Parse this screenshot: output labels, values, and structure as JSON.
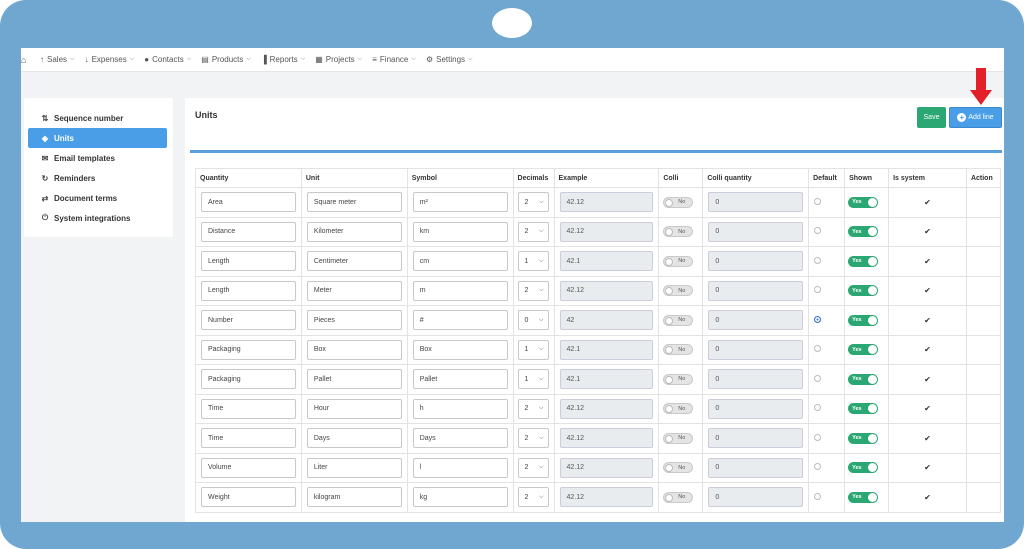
{
  "nav": {
    "items": [
      {
        "label": "Sales",
        "icon": "arrow-up-icon"
      },
      {
        "label": "Expenses",
        "icon": "arrow-down-icon"
      },
      {
        "label": "Contacts",
        "icon": "user-icon"
      },
      {
        "label": "Products",
        "icon": "cart-icon"
      },
      {
        "label": "Reports",
        "icon": "chart-icon"
      },
      {
        "label": "Projects",
        "icon": "calendar-icon"
      },
      {
        "label": "Finance",
        "icon": "money-icon"
      },
      {
        "label": "Settings",
        "icon": "gear-icon"
      }
    ]
  },
  "sidebar": {
    "items": [
      {
        "label": "Sequence number",
        "icon": "sort-icon",
        "active": false
      },
      {
        "label": "Units",
        "icon": "cube-icon",
        "active": true
      },
      {
        "label": "Email templates",
        "icon": "envelope-icon",
        "active": false
      },
      {
        "label": "Reminders",
        "icon": "refresh-icon",
        "active": false
      },
      {
        "label": "Document terms",
        "icon": "exchange-icon",
        "active": false
      },
      {
        "label": "System integrations",
        "icon": "plug-icon",
        "active": false
      }
    ]
  },
  "content": {
    "title": "Units",
    "save_label": "Save",
    "add_line_label": "Add line"
  },
  "table": {
    "headers": {
      "quantity": "Quantity",
      "unit": "Unit",
      "symbol": "Symbol",
      "decimals": "Decimals",
      "example": "Example",
      "colli": "Colli",
      "colli_quantity": "Colli quantity",
      "default": "Default",
      "shown": "Shown",
      "is_system": "Is system",
      "action": "Action"
    },
    "rows": [
      {
        "quantity": "Area",
        "unit": "Square meter",
        "symbol": "m²",
        "decimals": "2",
        "example": "42.12",
        "colli": "No",
        "colli_quantity": "0",
        "default": false,
        "shown": "Yes"
      },
      {
        "quantity": "Distance",
        "unit": "Kilometer",
        "symbol": "km",
        "decimals": "2",
        "example": "42.12",
        "colli": "No",
        "colli_quantity": "0",
        "default": false,
        "shown": "Yes"
      },
      {
        "quantity": "Length",
        "unit": "Centimeter",
        "symbol": "cm",
        "decimals": "1",
        "example": "42.1",
        "colli": "No",
        "colli_quantity": "0",
        "default": false,
        "shown": "Yes"
      },
      {
        "quantity": "Length",
        "unit": "Meter",
        "symbol": "m",
        "decimals": "2",
        "example": "42.12",
        "colli": "No",
        "colli_quantity": "0",
        "default": false,
        "shown": "Yes"
      },
      {
        "quantity": "Number",
        "unit": "Pieces",
        "symbol": "#",
        "decimals": "0",
        "example": "42",
        "colli": "No",
        "colli_quantity": "0",
        "default": true,
        "shown": "Yes"
      },
      {
        "quantity": "Packaging",
        "unit": "Box",
        "symbol": "Box",
        "decimals": "1",
        "example": "42.1",
        "colli": "No",
        "colli_quantity": "0",
        "default": false,
        "shown": "Yes"
      },
      {
        "quantity": "Packaging",
        "unit": "Pallet",
        "symbol": "Pallet",
        "decimals": "1",
        "example": "42.1",
        "colli": "No",
        "colli_quantity": "0",
        "default": false,
        "shown": "Yes"
      },
      {
        "quantity": "Time",
        "unit": "Hour",
        "symbol": "h",
        "decimals": "2",
        "example": "42.12",
        "colli": "No",
        "colli_quantity": "0",
        "default": false,
        "shown": "Yes"
      },
      {
        "quantity": "Time",
        "unit": "Days",
        "symbol": "Days",
        "decimals": "2",
        "example": "42.12",
        "colli": "No",
        "colli_quantity": "0",
        "default": false,
        "shown": "Yes"
      },
      {
        "quantity": "Volume",
        "unit": "Liter",
        "symbol": "l",
        "decimals": "2",
        "example": "42.12",
        "colli": "No",
        "colli_quantity": "0",
        "default": false,
        "shown": "Yes"
      },
      {
        "quantity": "Weight",
        "unit": "kilogram",
        "symbol": "kg",
        "decimals": "2",
        "example": "42.12",
        "colli": "No",
        "colli_quantity": "0",
        "default": false,
        "shown": "Yes"
      }
    ]
  },
  "colors": {
    "accent": "#4a9ee8",
    "save": "#2aa772",
    "toggle_on": "#2aa772",
    "annotation_arrow": "#e3202a",
    "frame": "#6fa7d1"
  }
}
